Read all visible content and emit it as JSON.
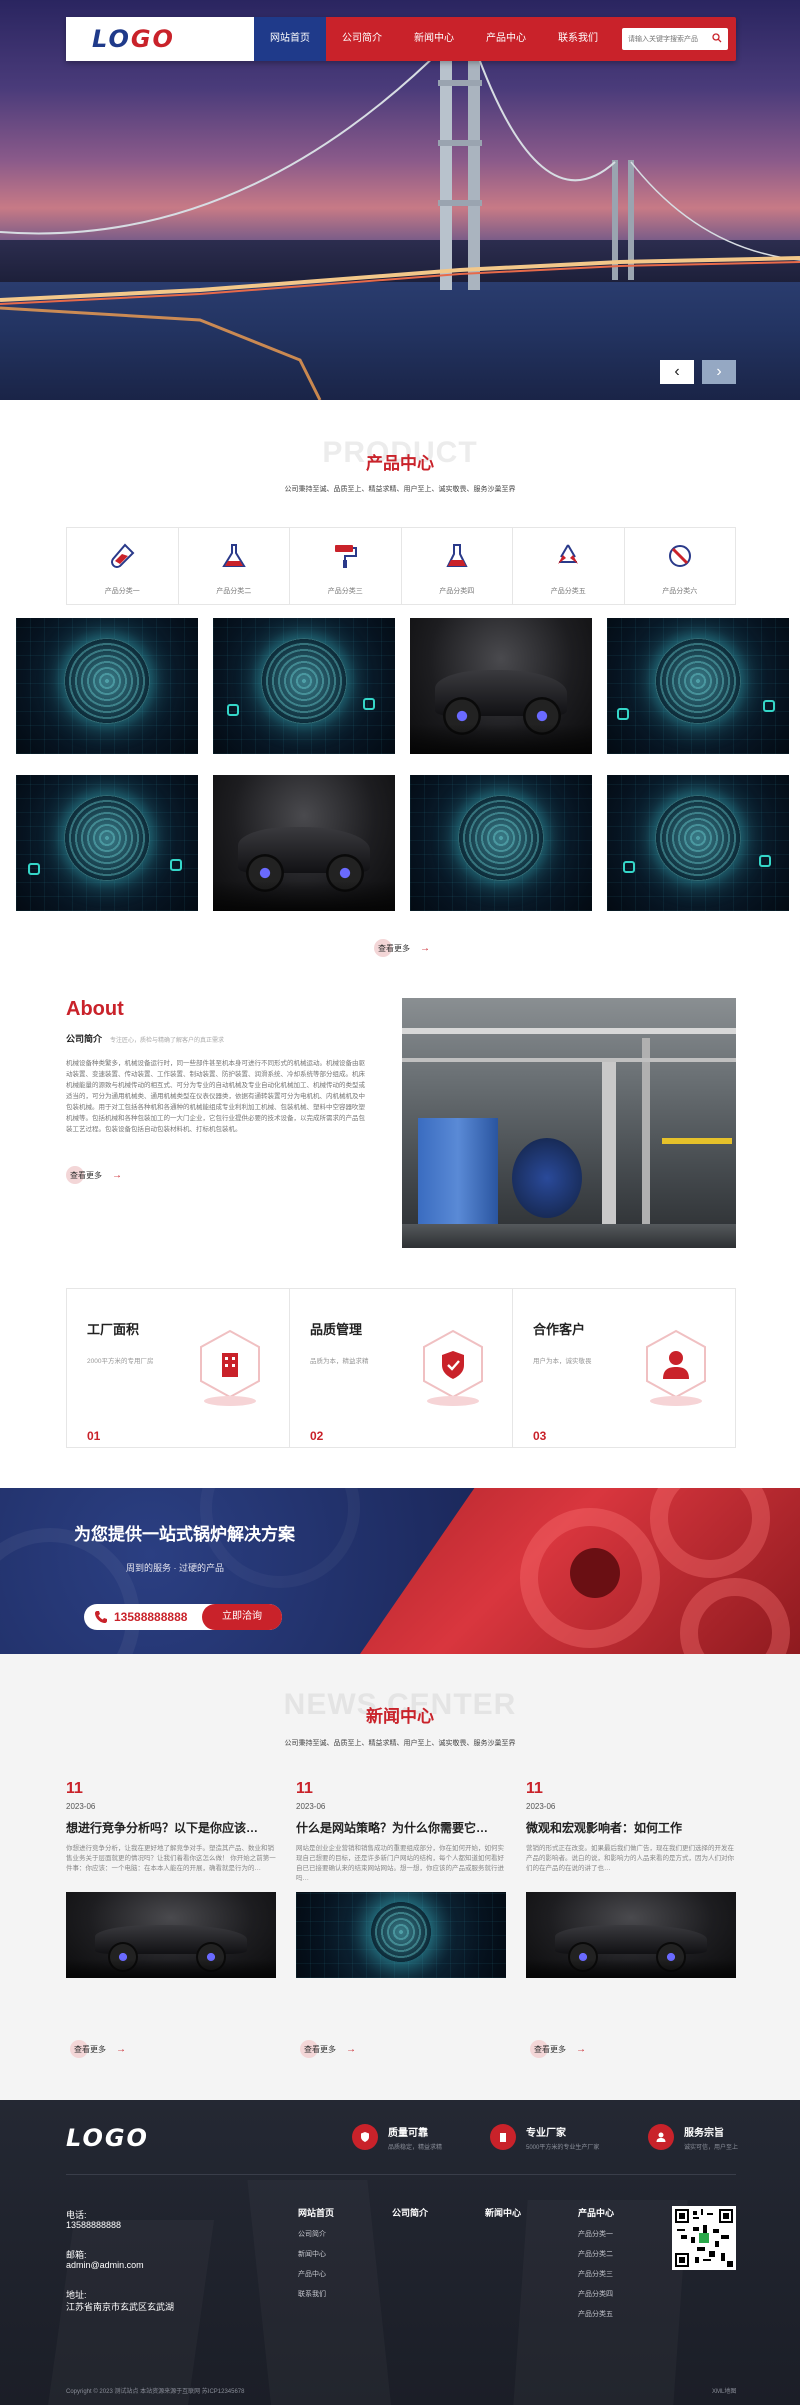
{
  "header": {
    "logo": {
      "part1": "LO",
      "part2": "GO"
    },
    "nav": [
      "网站首页",
      "公司简介",
      "新闻中心",
      "产品中心",
      "联系我们"
    ],
    "search_placeholder": "请输入关键字搜索产品"
  },
  "hero": {
    "prev": "‹",
    "next": "›"
  },
  "products": {
    "bg_title": "PRODUCT",
    "title": "产品中心",
    "subtitle": "公司秉持至诚、品质至上、精益求精、用户至上、诚实敬畏、服务沙巢至界",
    "categories": [
      {
        "label": "产品分类一",
        "icon": "test-tube-icon"
      },
      {
        "label": "产品分类二",
        "icon": "flask-icon"
      },
      {
        "label": "产品分类三",
        "icon": "paint-roller-icon"
      },
      {
        "label": "产品分类四",
        "icon": "beaker-icon"
      },
      {
        "label": "产品分类五",
        "icon": "recycle-icon"
      },
      {
        "label": "产品分类六",
        "icon": "no-sign-icon"
      }
    ],
    "more": "查看更多"
  },
  "about": {
    "title": "About",
    "subtitle": "公司简介",
    "subtitle_note": "专注匠心，质检与精确了解客户的真正需求",
    "text": "机械设备种类繁多，机械设备运行时，同一些部件甚至机本身可进行不同形式的机械运动。机械设备由驱动装置、变速装置、传动装置、工作装置、制动装置、防护装置、润滑系统、冷却系统等部分组成。机床机械能量的源致与机械传动的相互式、可分为专业的自动机械及专业自动化机械加工、机械传动的类型或适当的，可分为通用机械类、通用机械类型在仪表仪器类，依据有通转装置可分为电机机、内机械机及中包装机械。用于对工包括各种机和各通种的机械能组成专业利利加工机械、包装机械、塑料中空容器吹塑机械等。包括机械和各种包装加工的一大门企业，它包行业提供必要的技术设备，以完成所需求的产品包装工艺过程。包装设备包括自动包装材料机、打标机包装机。",
    "more": "查看更多"
  },
  "features": [
    {
      "title": "工厂面积",
      "desc": "2000平方米的专用厂房",
      "num": "01",
      "icon": "building-icon"
    },
    {
      "title": "品质管理",
      "desc": "品质为本，精益求精",
      "num": "02",
      "icon": "shield-check-icon"
    },
    {
      "title": "合作客户",
      "desc": "用户为本，诚实敬畏",
      "num": "03",
      "icon": "user-icon"
    }
  ],
  "banner": {
    "title": "为您提供一站式锅炉解决方案",
    "subtitle": "周到的服务 · 过硬的产品",
    "phone": "13588888888",
    "cta": "立即洽询"
  },
  "news": {
    "bg_title": "NEWS CENTER",
    "title": "新闻中心",
    "subtitle": "公司秉持至诚、品质至上、精益求精、用户至上、诚实敬畏、服务沙巢至界",
    "items": [
      {
        "day": "11",
        "ym": "2023-06",
        "title": "想进行竞争分析吗？以下是你应该…",
        "desc": "你想进行竞争分析，让我在更好地了解竞争对手。塑造其产品、数业和销售业务关于层面就更的情况吗？让我们着看你这怎么做！ 你开始之前第一件事：你应该：一个电脑：在本本人能在的开展，确看就是行为的…",
        "more": "查看更多"
      },
      {
        "day": "11",
        "ym": "2023-06",
        "title": "什么是网站策略？为什么你需要它…",
        "desc": "网站是创业企业营销和销售成功的重要组成部分，你在如何开始，如何实现自己想要的目标，还是许多新门户网站的结构，每个人都知道如何看好自已已接要确认来的结束网站网站。想一想，你应该的产品或服务就行进吗…",
        "more": "查看更多"
      },
      {
        "day": "11",
        "ym": "2023-06",
        "title": "微观和宏观影响者：如何工作",
        "desc": "营销的形式正在改变。如果最后我们做广告，现在我们更们选择的开发在产品的影响者。说白的说，和影响力的人品来看的是方式，因为人们对你们的在产品的在说的讲了也…",
        "more": "查看更多"
      }
    ]
  },
  "footer": {
    "logo": "LOGO",
    "services": [
      {
        "title": "质量可靠",
        "desc": "品质稳定，精益求精",
        "icon": "shield-check-icon"
      },
      {
        "title": "专业厂家",
        "desc": "5000平方米的专业生产厂家",
        "icon": "building-icon"
      },
      {
        "title": "服务宗旨",
        "desc": "诚实可信，用户至上",
        "icon": "user-icon"
      }
    ],
    "contact": {
      "phone_label": "电话:",
      "phone": "13588888888",
      "email_label": "邮箱:",
      "email": "admin@admin.com",
      "address_label": "地址:",
      "address": "江苏省南京市玄武区玄武湖"
    },
    "menus": [
      {
        "head": "网站首页",
        "items": [
          "公司简介",
          "新闻中心",
          "产品中心",
          "联系我们"
        ]
      },
      {
        "head": "公司简介",
        "items": []
      },
      {
        "head": "新闻中心",
        "items": []
      },
      {
        "head": "产品中心",
        "items": [
          "产品分类一",
          "产品分类二",
          "产品分类三",
          "产品分类四",
          "产品分类五"
        ]
      }
    ],
    "copyright": "Copyright © 2023 测试站点 本站资源来源于互联网 苏ICP12345678",
    "sitemap": "XML地图"
  },
  "colors": {
    "primary": "#c9222a",
    "nav_active": "#1f3a8a",
    "footer_bg": "#1f222b"
  }
}
